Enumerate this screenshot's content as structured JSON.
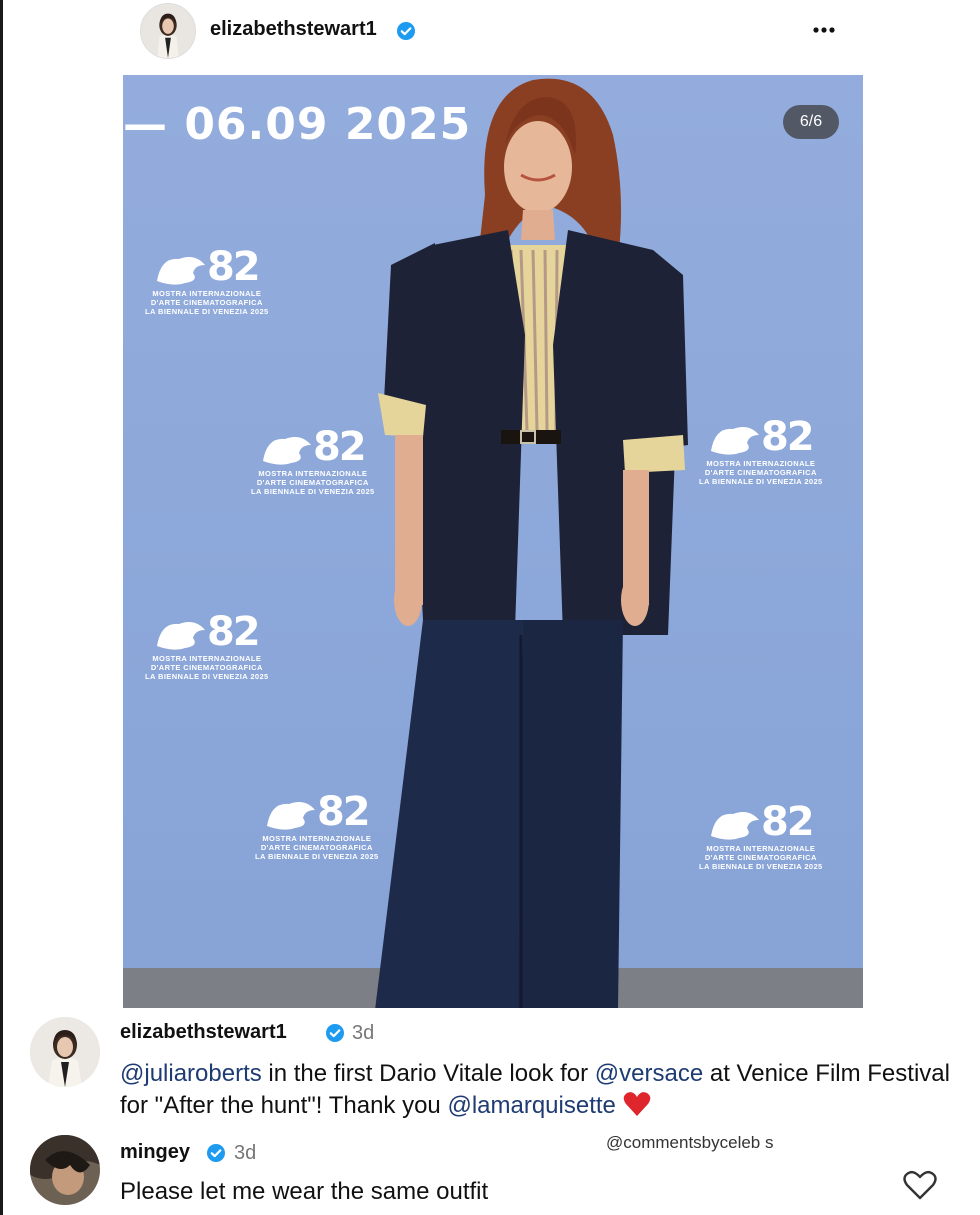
{
  "post": {
    "username": "elizabethstewart1",
    "image": {
      "date_text": "— 06.09 2025",
      "page_counter": "6/6",
      "backdrop": {
        "number": "82",
        "line1": "MOSTRA INTERNAZIONALE",
        "line2": "D'ARTE CINEMATOGRAFICA",
        "line3": "LA BIENNALE DI VENEZIA 2025"
      }
    }
  },
  "comments": [
    {
      "username": "elizabethstewart1",
      "time": "3d",
      "mention1": "@juliaroberts",
      "text1": " in the first Dario Vitale look for ",
      "mention2": "@versace",
      "text2": " at Venice Film Festival for \"After the hunt\"! Thank you ",
      "mention3": "@lamarquisette"
    },
    {
      "username": "mingey",
      "time": "3d",
      "text": "Please let me wear the same outfit"
    }
  ],
  "watermark": "@commentsbyceleb s",
  "icons": {
    "verified": "verified-badge-icon",
    "more": "more-options-icon",
    "heart_emoji": "red-heart-emoji",
    "like": "heart-outline-icon"
  },
  "colors": {
    "verified_blue": "#1d9bf0",
    "backdrop_blue": "#8fa9dc",
    "mention": "#1f3b73"
  }
}
